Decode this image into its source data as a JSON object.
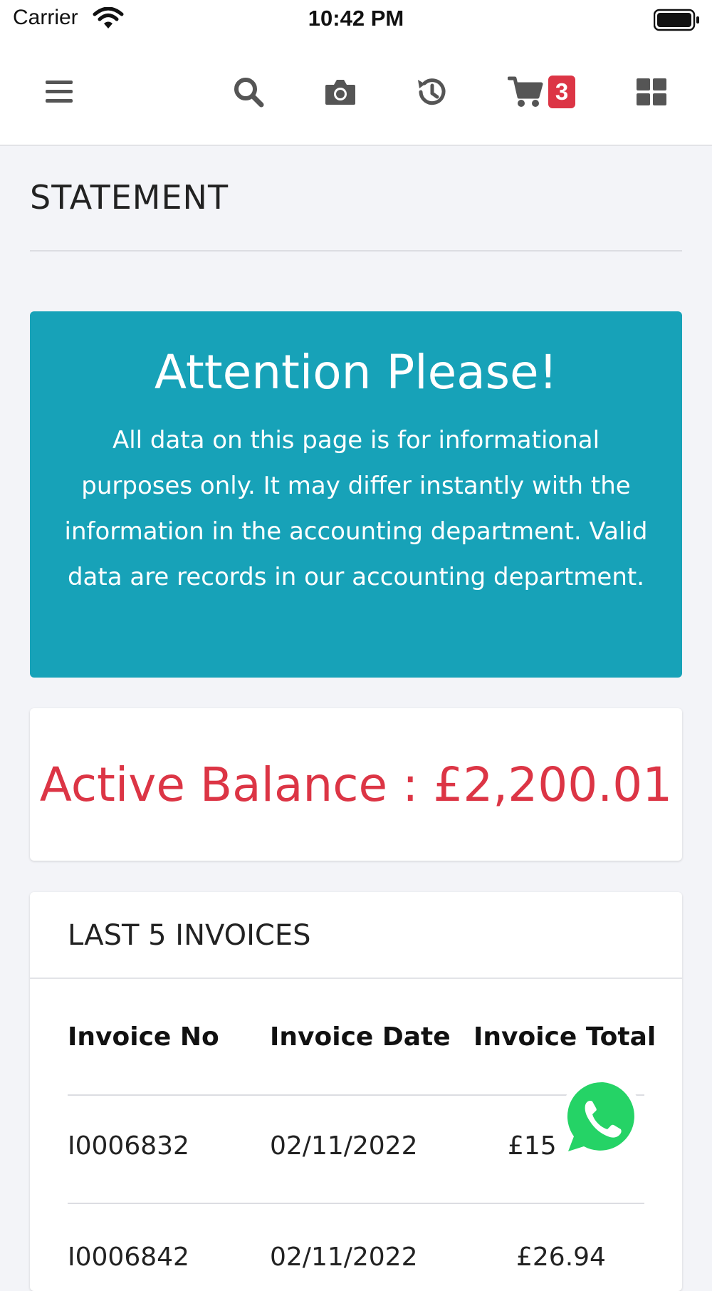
{
  "status_bar": {
    "carrier": "Carrier",
    "time": "10:42 PM"
  },
  "nav": {
    "icons": [
      "menu-icon",
      "search-icon",
      "camera-icon",
      "history-icon",
      "cart-icon",
      "grid-icon"
    ],
    "cart_count": "3"
  },
  "page": {
    "title": "STATEMENT"
  },
  "alert": {
    "title": "Attention Please!",
    "body": "All data on this page is for informational purposes only. It may differ instantly with the information in the accounting department. Valid data are records in our accounting department."
  },
  "balance": {
    "text": "Active Balance : £2,200.01"
  },
  "invoices": {
    "heading": "LAST 5 INVOICES",
    "columns": [
      "Invoice No",
      "Invoice Date",
      "Invoice Total"
    ],
    "rows": [
      {
        "no": "I0006832",
        "date": "02/11/2022",
        "total": "£15"
      },
      {
        "no": "I0006842",
        "date": "02/11/2022",
        "total": "£26.94"
      }
    ]
  },
  "colors": {
    "alert_bg": "#17a2b8",
    "danger": "#dc3545",
    "whatsapp": "#25d366"
  }
}
